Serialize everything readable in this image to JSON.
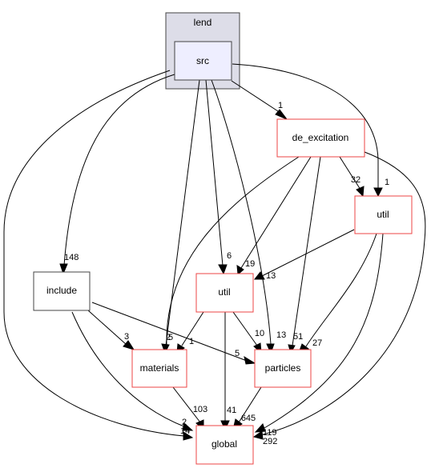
{
  "graph": {
    "cluster": {
      "label": "lend",
      "fill": "#dddde8",
      "stroke": "#444444"
    },
    "nodes": {
      "src": {
        "label": "src",
        "fill": "#eeeeff",
        "stroke": "#444444"
      },
      "de_excitation": {
        "label": "de_excitation",
        "fill": "#ffffff",
        "stroke": "#ee4444"
      },
      "util_top": {
        "label": "util",
        "fill": "#ffffff",
        "stroke": "#ee4444"
      },
      "include": {
        "label": "include",
        "fill": "#ffffff",
        "stroke": "#444444"
      },
      "util_mid": {
        "label": "util",
        "fill": "#ffffff",
        "stroke": "#ee4444"
      },
      "materials": {
        "label": "materials",
        "fill": "#ffffff",
        "stroke": "#ee4444"
      },
      "particles": {
        "label": "particles",
        "fill": "#ffffff",
        "stroke": "#ee4444"
      },
      "global": {
        "label": "global",
        "fill": "#ffffff",
        "stroke": "#ee4444"
      }
    },
    "edges": [
      {
        "from": "src",
        "to": "de_excitation",
        "label": "1"
      },
      {
        "from": "src",
        "to": "util_top",
        "label": "1"
      },
      {
        "from": "src",
        "to": "include",
        "label": "148"
      },
      {
        "from": "src",
        "to": "util_mid",
        "label": "6"
      },
      {
        "from": "src",
        "to": "materials",
        "label": "2"
      },
      {
        "from": "src",
        "to": "particles",
        "label": "13"
      },
      {
        "from": "src",
        "to": "global",
        "label": "14"
      },
      {
        "from": "de_excitation",
        "to": "util_top",
        "label": "32"
      },
      {
        "from": "de_excitation",
        "to": "util_mid",
        "label": "19"
      },
      {
        "from": "de_excitation",
        "to": "materials",
        "label": "5"
      },
      {
        "from": "de_excitation",
        "to": "particles",
        "label": "51"
      },
      {
        "from": "de_excitation",
        "to": "global",
        "label": "292"
      },
      {
        "from": "util_top",
        "to": "util_mid",
        "label": "13"
      },
      {
        "from": "util_top",
        "to": "particles",
        "label": "27"
      },
      {
        "from": "util_top",
        "to": "global",
        "label": "119"
      },
      {
        "from": "include",
        "to": "materials",
        "label": "3"
      },
      {
        "from": "include",
        "to": "particles",
        "label": "5"
      },
      {
        "from": "include",
        "to": "global",
        "label": "2"
      },
      {
        "from": "util_mid",
        "to": "materials",
        "label": "1"
      },
      {
        "from": "util_mid",
        "to": "particles",
        "label": "10"
      },
      {
        "from": "util_mid",
        "to": "global",
        "label": "41"
      },
      {
        "from": "materials",
        "to": "global",
        "label": "103"
      },
      {
        "from": "particles",
        "to": "global",
        "label": "645"
      }
    ]
  }
}
